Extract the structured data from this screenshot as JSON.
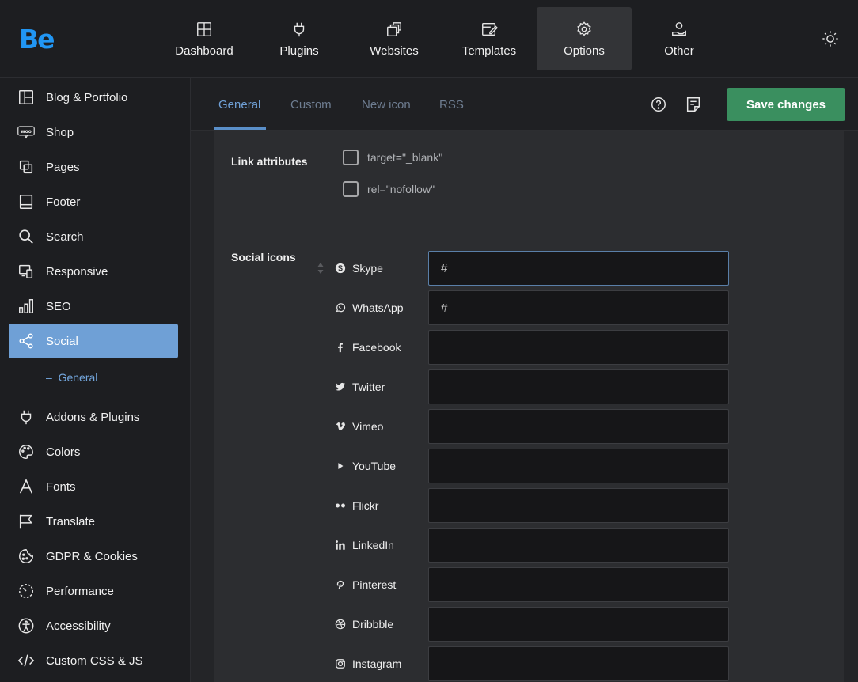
{
  "app": {
    "logo": "Be"
  },
  "topnav": [
    {
      "label": "Dashboard",
      "icon": "dashboard-icon",
      "active": false
    },
    {
      "label": "Plugins",
      "icon": "plug-icon",
      "active": false
    },
    {
      "label": "Websites",
      "icon": "websites-icon",
      "active": false
    },
    {
      "label": "Templates",
      "icon": "templates-icon",
      "active": false
    },
    {
      "label": "Options",
      "icon": "gear-icon",
      "active": true
    },
    {
      "label": "Other",
      "icon": "other-icon",
      "active": false
    }
  ],
  "sidebar": {
    "items": [
      {
        "label": "Blog & Portfolio",
        "icon": "layout-icon"
      },
      {
        "label": "Shop",
        "icon": "woo-icon"
      },
      {
        "label": "Pages",
        "icon": "pages-icon"
      },
      {
        "label": "Footer",
        "icon": "footer-icon"
      },
      {
        "label": "Search",
        "icon": "search-icon"
      },
      {
        "label": "Responsive",
        "icon": "responsive-icon"
      },
      {
        "label": "SEO",
        "icon": "seo-icon"
      },
      {
        "label": "Social",
        "icon": "share-icon",
        "active": true
      },
      {
        "label": "Addons & Plugins",
        "icon": "plug-icon"
      },
      {
        "label": "Colors",
        "icon": "palette-icon"
      },
      {
        "label": "Fonts",
        "icon": "font-icon"
      },
      {
        "label": "Translate",
        "icon": "flag-icon"
      },
      {
        "label": "GDPR & Cookies",
        "icon": "cookie-icon"
      },
      {
        "label": "Performance",
        "icon": "gauge-icon"
      },
      {
        "label": "Accessibility",
        "icon": "accessibility-icon"
      },
      {
        "label": "Custom CSS & JS",
        "icon": "code-icon"
      }
    ],
    "subitem": "General",
    "subitem_prefix": "–"
  },
  "tabs": [
    {
      "label": "General",
      "active": true
    },
    {
      "label": "Custom",
      "active": false
    },
    {
      "label": "New icon",
      "active": false
    },
    {
      "label": "RSS",
      "active": false
    }
  ],
  "toolbar": {
    "save_label": "Save changes",
    "help_icon": "help-icon",
    "notes_icon": "notes-icon"
  },
  "link_attributes": {
    "label": "Link attributes",
    "options": [
      {
        "label": "target=\"_blank\"",
        "checked": false
      },
      {
        "label": "rel=\"nofollow\"",
        "checked": false
      }
    ]
  },
  "social_icons": {
    "label": "Social icons",
    "items": [
      {
        "name": "Skype",
        "icon": "skype-icon",
        "value": "#",
        "focused": true
      },
      {
        "name": "WhatsApp",
        "icon": "whatsapp-icon",
        "value": "#"
      },
      {
        "name": "Facebook",
        "icon": "facebook-icon",
        "value": ""
      },
      {
        "name": "Twitter",
        "icon": "twitter-icon",
        "value": ""
      },
      {
        "name": "Vimeo",
        "icon": "vimeo-icon",
        "value": ""
      },
      {
        "name": "YouTube",
        "icon": "youtube-icon",
        "value": ""
      },
      {
        "name": "Flickr",
        "icon": "flickr-icon",
        "value": ""
      },
      {
        "name": "LinkedIn",
        "icon": "linkedin-icon",
        "value": ""
      },
      {
        "name": "Pinterest",
        "icon": "pinterest-icon",
        "value": ""
      },
      {
        "name": "Dribbble",
        "icon": "dribbble-icon",
        "value": ""
      },
      {
        "name": "Instagram",
        "icon": "instagram-icon",
        "value": ""
      }
    ]
  },
  "colors": {
    "accent": "#6fa0d6",
    "save": "#3a8f5f",
    "logo": "#2196f3"
  }
}
